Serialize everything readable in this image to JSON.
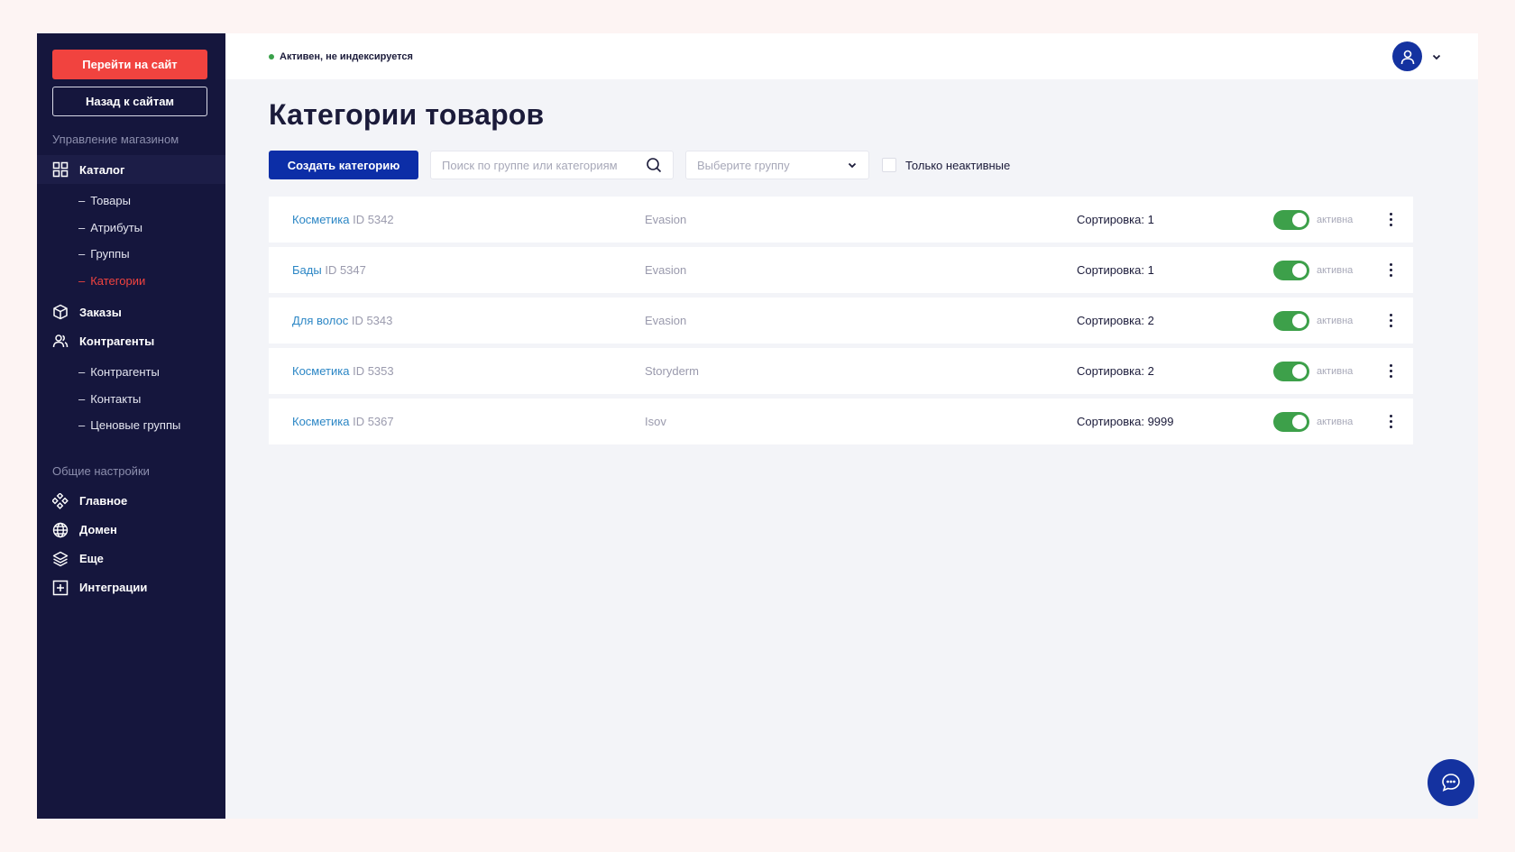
{
  "sidebar": {
    "go_to_site": "Перейти на сайт",
    "back_to_sites": "Назад к сайтам",
    "section_shop": "Управление магазином",
    "catalog": "Каталог",
    "catalog_sub": [
      "Товары",
      "Атрибуты",
      "Группы",
      "Категории"
    ],
    "orders": "Заказы",
    "counterparties": "Контрагенты",
    "counterparties_sub": [
      "Контрагенты",
      "Контакты",
      "Ценовые группы"
    ],
    "section_general": "Общие настройки",
    "general": [
      "Главное",
      "Домен",
      "Еще",
      "Интеграции"
    ],
    "dash": "–"
  },
  "topbar": {
    "status": "Активен, не индексируется",
    "status_color": "#3aa14a"
  },
  "page": {
    "title": "Категории товаров",
    "create_button": "Создать категорию",
    "search_placeholder": "Поиск по группе или категориям",
    "group_select": "Выберите группу",
    "only_inactive": "Только неактивные"
  },
  "rows": [
    {
      "name": "Косметика",
      "id": "ID 5342",
      "group": "Evasion",
      "sort": "Сортировка: 1",
      "state": "активна"
    },
    {
      "name": "Бады",
      "id": "ID 5347",
      "group": "Evasion",
      "sort": "Сортировка: 1",
      "state": "активна"
    },
    {
      "name": "Для волос",
      "id": "ID 5343",
      "group": "Evasion",
      "sort": "Сортировка: 2",
      "state": "активна"
    },
    {
      "name": "Косметика",
      "id": "ID 5353",
      "group": "Storyderm",
      "sort": "Сортировка: 2",
      "state": "активна"
    },
    {
      "name": "Косметика",
      "id": "ID 5367",
      "group": "Isov",
      "sort": "Сортировка: 9999",
      "state": "активна"
    }
  ],
  "colors": {
    "sidebar_bg": "#15163d",
    "accent_red": "#f1433f",
    "primary_blue": "#0c2ea7",
    "toggle_green": "#3da04a",
    "link_blue": "#2b86c5"
  }
}
